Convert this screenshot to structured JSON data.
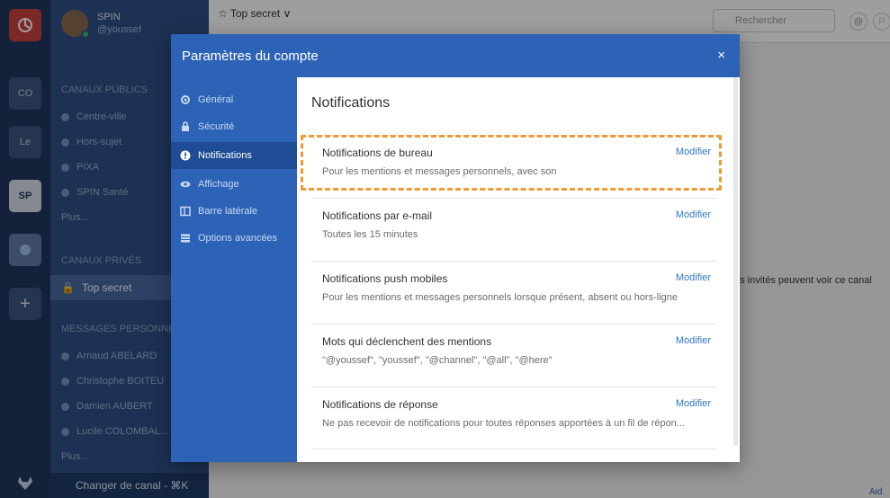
{
  "team_sidebar": {
    "teams": [
      {
        "label": "CO"
      },
      {
        "label": "Le"
      },
      {
        "label": "SP"
      }
    ],
    "add_label": "+"
  },
  "channel_sidebar": {
    "team_name": "SPIN",
    "user_handle": "@youssef",
    "public_section": "CANAUX PUBLICS",
    "public_channels": [
      "Centre-ville",
      "Hors-sujet",
      "PIXA",
      "SPIN Santé"
    ],
    "public_more": "Plus...",
    "private_section": "CANAUX PRIVÉS",
    "active_channel": "Top secret",
    "dm_section": "MESSAGES PERSONNE",
    "dm_users": [
      "Arnaud ABELARD",
      "Christophe BOITEU",
      "Damien AUBERT",
      "Lucile COLOMBAL..."
    ],
    "dm_more": "Plus...",
    "switch_label": "Changer de canal - ⌘K"
  },
  "main": {
    "channel_title": "☆ Top secret ∨",
    "search_placeholder": "Rechercher",
    "at_icon": "@",
    "flag_icon": "⚐",
    "guest_note": "es invités peuvent voir ce canal",
    "help_link": "Aid"
  },
  "modal": {
    "title": "Paramètres du compte",
    "close": "×",
    "nav": [
      {
        "label": "Général",
        "icon": "gear-icon"
      },
      {
        "label": "Sécurité",
        "icon": "lock-icon"
      },
      {
        "label": "Notifications",
        "icon": "alert-icon"
      },
      {
        "label": "Affichage",
        "icon": "eye-icon"
      },
      {
        "label": "Barre latérale",
        "icon": "columns-icon"
      },
      {
        "label": "Options avancées",
        "icon": "list-icon"
      }
    ],
    "active_nav": "Notifications",
    "content_title": "Notifications",
    "settings": [
      {
        "title": "Notifications de bureau",
        "desc": "Pour les mentions et messages personnels, avec son",
        "edit": "Modifier"
      },
      {
        "title": "Notifications par e-mail",
        "desc": "Toutes les 15 minutes",
        "edit": "Modifier"
      },
      {
        "title": "Notifications push mobiles",
        "desc": "Pour les mentions et messages personnels lorsque présent, absent ou hors-ligne",
        "edit": "Modifier"
      },
      {
        "title": "Mots qui déclenchent des mentions",
        "desc": "\"@youssef\", \"youssef\", \"@channel\", \"@all\", \"@here\"",
        "edit": "Modifier"
      },
      {
        "title": "Notifications de réponse",
        "desc": "Ne pas recevoir de notifications pour toutes réponses apportées à un fil de répon...",
        "edit": "Modifier"
      }
    ]
  },
  "colors": {
    "modal_blue": "#2c63b6",
    "highlight_orange": "#ef9a34",
    "link_blue": "#2f76c7"
  }
}
